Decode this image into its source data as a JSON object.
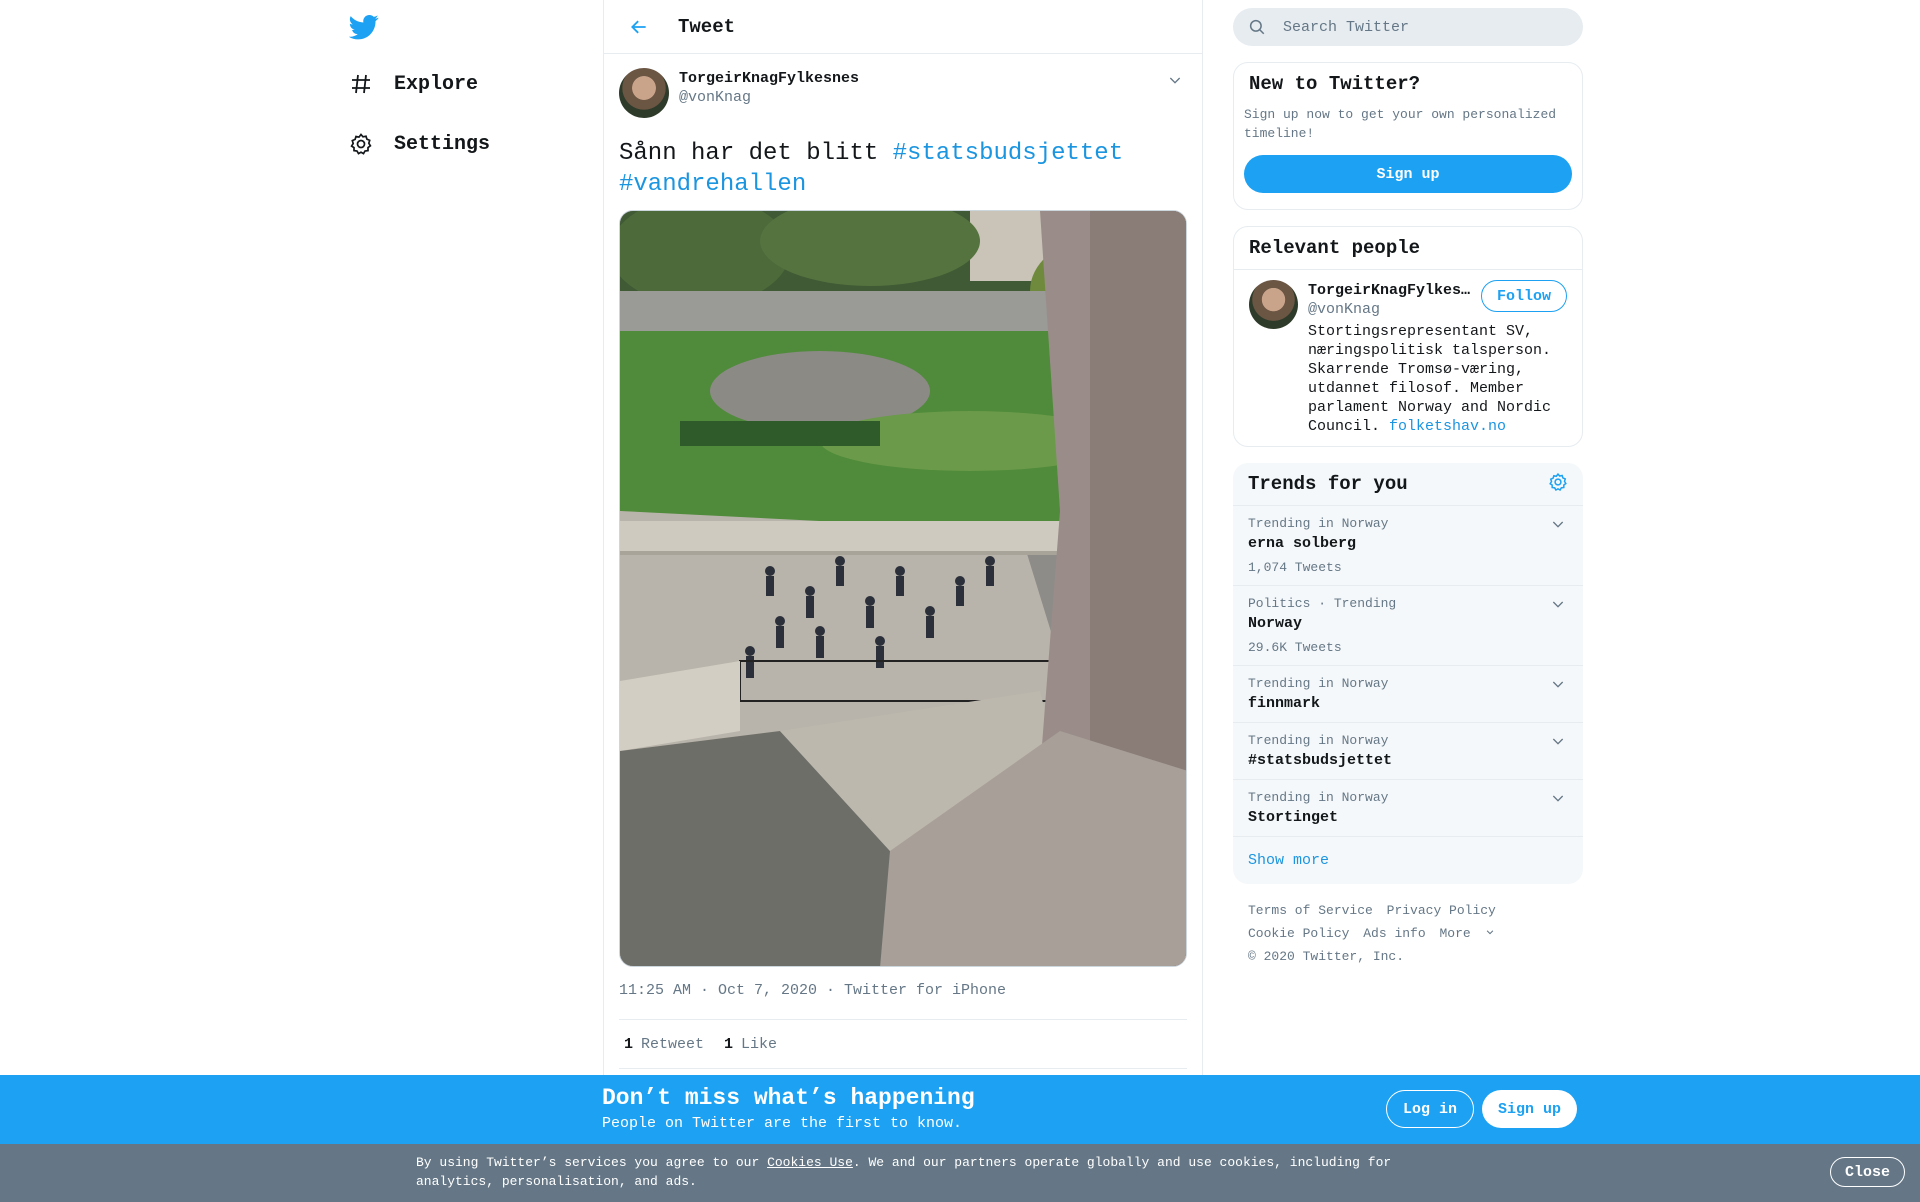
{
  "nav": {
    "explore_label": "Explore",
    "settings_label": "Settings"
  },
  "header": {
    "title": "Tweet"
  },
  "tweet": {
    "author_name": "TorgeirKnagFylkesnes",
    "author_handle": "@vonKnag",
    "text_plain": "Sånn har det blitt ",
    "hashtag1": "#statsbudsjettet",
    "hashtag2": "#vandrehallen",
    "meta": "11:25 AM · Oct 7, 2020 · Twitter for iPhone",
    "retweet_count": "1",
    "retweet_label": "Retweet",
    "like_count": "1",
    "like_label": "Like"
  },
  "search": {
    "placeholder": "Search Twitter"
  },
  "new_to_twitter": {
    "title": "New to Twitter?",
    "text": "Sign up now to get your own personalized timeline!",
    "signup_label": "Sign up"
  },
  "relevant_people": {
    "title": "Relevant people",
    "person": {
      "name": "TorgeirKnagFylkesnes",
      "handle": "@vonKnag",
      "bio": "Stortingsrepresentant SV, næringspolitisk talsperson. Skarrende Tromsø-væring, utdannet filosof. Member parlament Norway and Nordic Council. ",
      "bio_link": "folketshav.no",
      "follow_label": "Follow"
    }
  },
  "trends": {
    "title": "Trends for you",
    "items": [
      {
        "context": "Trending in Norway",
        "name": "erna solberg",
        "count": "1,074 Tweets"
      },
      {
        "context": "Politics · Trending",
        "name": "Norway",
        "count": "29.6K Tweets"
      },
      {
        "context": "Trending in Norway",
        "name": "finnmark",
        "count": ""
      },
      {
        "context": "Trending in Norway",
        "name": "#statsbudsjettet",
        "count": ""
      },
      {
        "context": "Trending in Norway",
        "name": "Stortinget",
        "count": ""
      }
    ],
    "show_more": "Show more"
  },
  "footer": {
    "terms": "Terms of Service",
    "privacy": "Privacy Policy",
    "cookie": "Cookie Policy",
    "ads": "Ads info",
    "more": "More",
    "copyright": "© 2020 Twitter, Inc."
  },
  "banner": {
    "title": "Don’t miss what’s happening",
    "subtitle": "People on Twitter are the first to know.",
    "login_label": "Log in",
    "signup_label": "Sign up"
  },
  "cookie_bar": {
    "text_before": "By using Twitter’s services you agree to our ",
    "link": "Cookies Use",
    "text_after": ". We and our partners operate globally and use cookies, including for analytics, personalisation, and ads.",
    "close_label": "Close"
  },
  "colors": {
    "brand": "#1da1f2",
    "link": "#1b95e0",
    "secondary_text": "#657786"
  }
}
